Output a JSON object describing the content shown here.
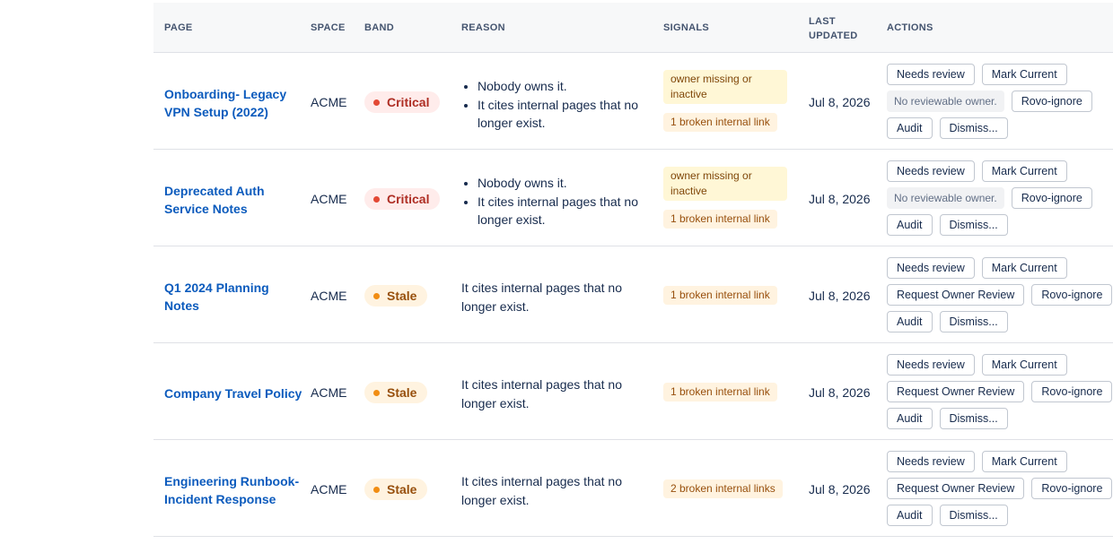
{
  "headers": {
    "page": "PAGE",
    "space": "SPACE",
    "band": "BAND",
    "reason": "REASON",
    "signals": "SIGNALS",
    "last_updated_1": "LAST",
    "last_updated_2": "UPDATED",
    "actions": "ACTIONS"
  },
  "colors": {
    "link": "#0c5bbd",
    "critical": "#ae2e24",
    "stale": "#974f0c",
    "header_bg": "#f7f8f9"
  },
  "rows": [
    {
      "page_line1": "Onboarding- Legacy",
      "page_line2": "VPN Setup (2022)",
      "space": "ACME",
      "band": "Critical",
      "reason_1": "Nobody owns it.",
      "reason_2": "It cites internal pages that no longer exist.",
      "signal_owner": "owner missing or inactive",
      "signal_link": "1 broken internal link",
      "updated": "Jul 8, 2026",
      "actions": {
        "needs_review": "Needs review",
        "mark_current": "Mark Current",
        "note": "No reviewable owner.",
        "rovo_ignore": "Rovo-ignore",
        "audit": "Audit",
        "dismiss": "Dismiss..."
      }
    },
    {
      "page_line1": "Deprecated Auth",
      "page_line2": "Service Notes",
      "space": "ACME",
      "band": "Critical",
      "reason_1": "Nobody owns it.",
      "reason_2": "It cites internal pages that no longer exist.",
      "signal_owner": "owner missing or inactive",
      "signal_link": "1 broken internal link",
      "updated": "Jul 8, 2026",
      "actions": {
        "needs_review": "Needs review",
        "mark_current": "Mark Current",
        "note": "No reviewable owner.",
        "rovo_ignore": "Rovo-ignore",
        "audit": "Audit",
        "dismiss": "Dismiss..."
      }
    },
    {
      "page_line1": "Q1 2024 Planning",
      "page_line2": "Notes",
      "space": "ACME",
      "band": "Stale",
      "reason": "It cites internal pages that no longer exist.",
      "signal_link": "1 broken internal link",
      "updated": "Jul 8, 2026",
      "actions": {
        "needs_review": "Needs review",
        "mark_current": "Mark Current",
        "request_owner": "Request Owner Review",
        "rovo_ignore": "Rovo-ignore",
        "audit": "Audit",
        "dismiss": "Dismiss..."
      }
    },
    {
      "page_line1": "Company Travel Policy",
      "page_line2": "",
      "space": "ACME",
      "band": "Stale",
      "reason": "It cites internal pages that no longer exist.",
      "signal_link": "1 broken internal link",
      "updated": "Jul 8, 2026",
      "actions": {
        "needs_review": "Needs review",
        "mark_current": "Mark Current",
        "request_owner": "Request Owner Review",
        "rovo_ignore": "Rovo-ignore",
        "audit": "Audit",
        "dismiss": "Dismiss..."
      }
    },
    {
      "page_line1": "Engineering Runbook-",
      "page_line2": "Incident Response",
      "space": "ACME",
      "band": "Stale",
      "reason": "It cites internal pages that no longer exist.",
      "signal_link": "2 broken internal links",
      "updated": "Jul 8, 2026",
      "actions": {
        "needs_review": "Needs review",
        "mark_current": "Mark Current",
        "request_owner": "Request Owner Review",
        "rovo_ignore": "Rovo-ignore",
        "audit": "Audit",
        "dismiss": "Dismiss..."
      }
    }
  ]
}
